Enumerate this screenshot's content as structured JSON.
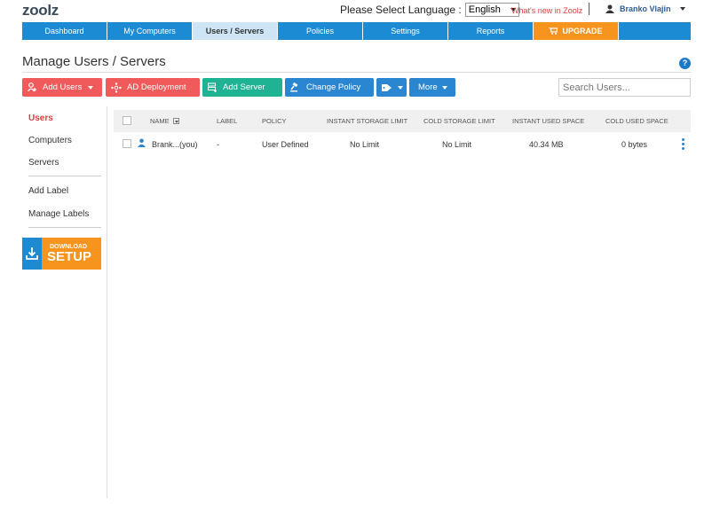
{
  "header": {
    "logo": "zoolz",
    "language_label": "Please Select Language :",
    "language_value": "English",
    "whats_new": "What's new in Zoolz",
    "user_name": "Branko Vlajin"
  },
  "nav": {
    "tabs": [
      {
        "label": "Dashboard",
        "active": false
      },
      {
        "label": "My Computers",
        "active": false
      },
      {
        "label": "Users / Servers",
        "active": true
      },
      {
        "label": "Policies",
        "active": false
      },
      {
        "label": "Settings",
        "active": false
      },
      {
        "label": "Reports",
        "active": false
      }
    ],
    "upgrade_label": "UPGRADE"
  },
  "page": {
    "title": "Manage Users / Servers",
    "help": "?"
  },
  "toolbar": {
    "add_users": "Add Users",
    "ad_deployment": "AD Deployment",
    "add_server": "Add Server",
    "change_policy": "Change Policy",
    "more": "More",
    "search_placeholder": "Search Users..."
  },
  "sidebar": {
    "items": [
      "Users",
      "Computers",
      "Servers"
    ],
    "actions": [
      "Add Label",
      "Manage Labels"
    ],
    "download_small": "DOWNLOAD",
    "download_big": "SETUP"
  },
  "table": {
    "columns": {
      "name": "NAME",
      "label": "LABEL",
      "policy": "POLICY",
      "instant_limit": "INSTANT STORAGE LIMIT",
      "cold_limit": "COLD STORAGE LIMIT",
      "instant_used": "INSTANT USED SPACE",
      "cold_used": "COLD USED SPACE"
    },
    "rows": [
      {
        "name": "Brank...(you)",
        "label": "-",
        "policy": "User Defined",
        "instant_limit": "No Limit",
        "cold_limit": "No Limit",
        "instant_used": "40.34 MB",
        "cold_used": "0 bytes"
      }
    ]
  },
  "colors": {
    "nav_blue": "#1c8bd4",
    "active_tab": "#cde5f5",
    "upgrade_orange": "#f7941d",
    "red_button": "#f05a5a",
    "green_button": "#20b393",
    "blue_button": "#2a86d0",
    "active_side": "#e03c3c"
  }
}
